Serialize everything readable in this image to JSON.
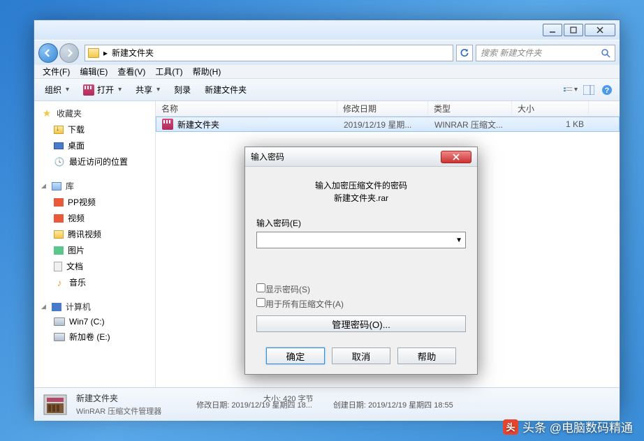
{
  "window": {
    "address": {
      "path_icon": "folder-icon",
      "crumb_sep": "▸",
      "crumb": "新建文件夹"
    },
    "search": {
      "placeholder": "搜索 新建文件夹"
    },
    "menu": [
      "文件(F)",
      "编辑(E)",
      "查看(V)",
      "工具(T)",
      "帮助(H)"
    ],
    "toolbar": {
      "organize": "组织",
      "open": "打开",
      "share": "共享",
      "burn": "刻录",
      "newfolder": "新建文件夹"
    },
    "columns": {
      "name": "名称",
      "date": "修改日期",
      "type": "类型",
      "size": "大小"
    },
    "file_row": {
      "name": "新建文件夹",
      "date": "2019/12/19 星期...",
      "type": "WINRAR 压缩文...",
      "size": "1 KB"
    },
    "sidebar": {
      "favorites": {
        "label": "收藏夹",
        "items": [
          "下载",
          "桌面",
          "最近访问的位置"
        ]
      },
      "libraries": {
        "label": "库",
        "items": [
          "PP视频",
          "视频",
          "腾讯视频",
          "图片",
          "文档",
          "音乐"
        ]
      },
      "computer": {
        "label": "计算机",
        "items": [
          "Win7 (C:)",
          "新加卷 (E:)"
        ]
      }
    },
    "status": {
      "title": "新建文件夹",
      "subtitle": "WinRAR 压缩文件管理器",
      "mod_label": "修改日期:",
      "mod_value": "2019/12/19 星期四 18...",
      "create_label": "创建日期:",
      "create_value": "2019/12/19 星期四 18:55",
      "size_label": "大小:",
      "size_value": "420 字节"
    }
  },
  "dialog": {
    "title": "输入密码",
    "msg_line1": "输入加密压缩文件的密码",
    "msg_line2": "新建文件夹.rar",
    "input_label": "输入密码(E)",
    "show_pwd": "显示密码(S)",
    "all_files": "用于所有压缩文件(A)",
    "manage": "管理密码(O)...",
    "ok": "确定",
    "cancel": "取消",
    "help": "帮助"
  },
  "watermark": "头条 @电脑数码精通"
}
